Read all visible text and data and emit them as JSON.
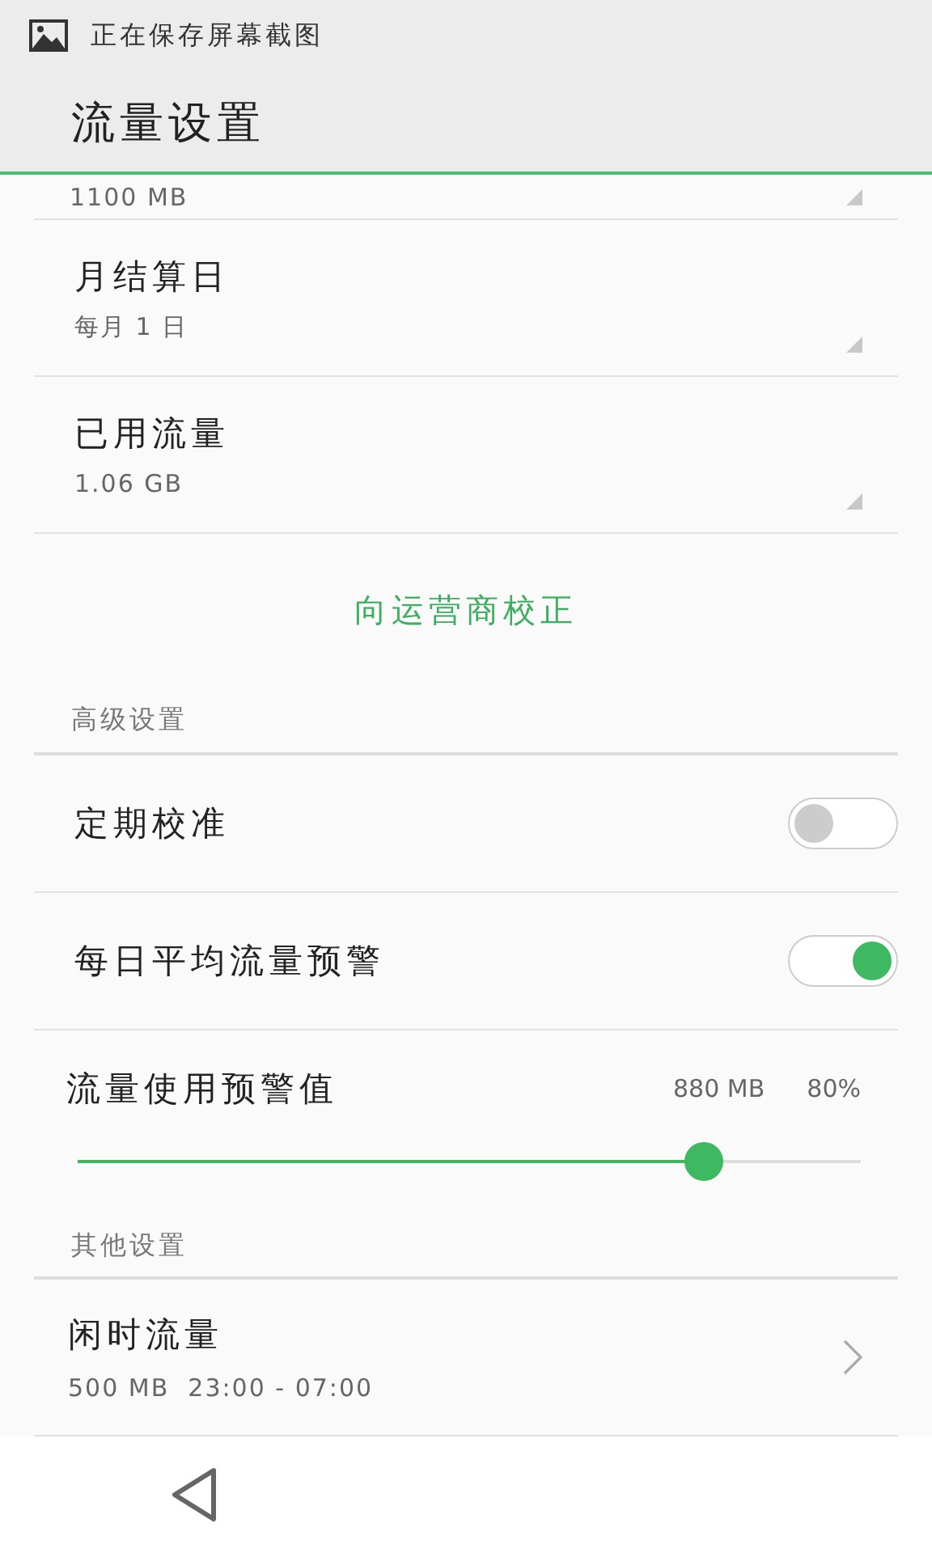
{
  "status_bar": {
    "notification": "正在保存屏幕截图"
  },
  "header": {
    "title": "流量设置"
  },
  "top_items": [
    {
      "kind": "partial",
      "value": "1100 MB"
    },
    {
      "kind": "dropdown",
      "label": "月结算日",
      "value": "每月 1 日"
    },
    {
      "kind": "dropdown",
      "label": "已用流量",
      "value": "1.06 GB"
    }
  ],
  "calibrate_link": "向运营商校正",
  "advanced": {
    "title": "高级设置",
    "toggles": [
      {
        "label": "定期校准",
        "on": false
      },
      {
        "label": "每日平均流量预警",
        "on": true
      }
    ],
    "slider": {
      "label": "流量使用预警值",
      "amount": "880 MB",
      "percent": "80%",
      "level": 0.8
    }
  },
  "other": {
    "title": "其他设置",
    "items": [
      {
        "label": "闲时流量",
        "value": "500 MB  23:00 - 07:00"
      }
    ]
  }
}
